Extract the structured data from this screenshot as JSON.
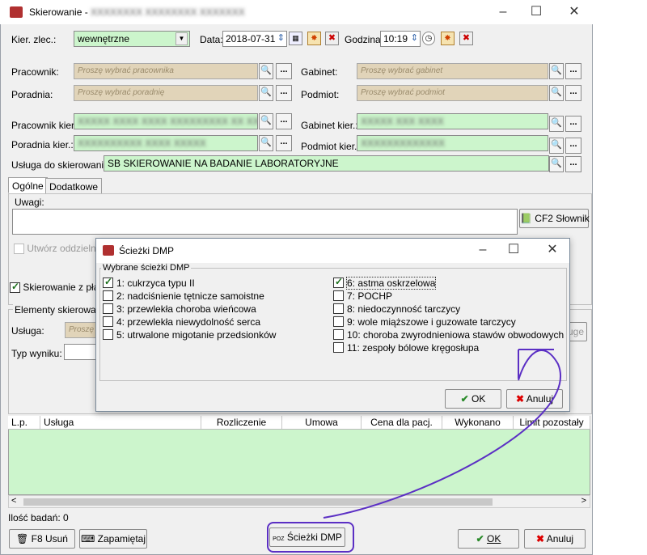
{
  "window": {
    "title": "Skierowanie -",
    "title_blurred": "XXXXXXXX XXXXXXXX XXXXXXX"
  },
  "form": {
    "kier_zlec_label": "Kier. zlec.:",
    "kier_zlec_value": "wewnętrzne",
    "data_label": "Data:",
    "data_value": "2018-07-31",
    "godzina_label": "Godzina:",
    "godzina_value": "10:19",
    "pracownik_label": "Pracownik:",
    "pracownik_placeholder": "Proszę wybrać pracownika",
    "poradnia_label": "Poradnia:",
    "poradnia_placeholder": "Proszę wybrać poradnię",
    "gabinet_label": "Gabinet:",
    "gabinet_placeholder": "Proszę wybrać gabinet",
    "podmiot_label": "Podmiot:",
    "podmiot_placeholder": "Proszę wybrać podmiot",
    "pracownik_kier_label": "Pracownik kier.:",
    "pracownik_kier_value": "XXXXX XXXX XXXX XXXXXXXXX XX XX",
    "poradnia_kier_label": "Poradnia kier.:",
    "poradnia_kier_value": "XXXXXXXXXX XXXX XXXXX",
    "gabinet_kier_label": "Gabinet kier.:",
    "gabinet_kier_value": "XXXXX XXX XXXX",
    "podmiot_kier_label": "Podmiot kier.:",
    "podmiot_kier_value": "XXXXXXXXXXXXX",
    "usluga_label": "Usługa do skierowania:",
    "usluga_value": "SB SKIEROWANIE NA BADANIE LABORATORYJNE"
  },
  "tabs": [
    "Ogólne",
    "Dodatkowe"
  ],
  "uwagi_label": "Uwagi:",
  "slownik_label": "CF2 Słownik",
  "utworz_label": "Utwórz oddzielne",
  "skierowanie_z_platn_label": "Skierowanie z płat",
  "elementy_label": "Elementy skierowania",
  "usluga2_label": "Usługa:",
  "usluga2_placeholder": "Proszę",
  "typ_wyniku_label": "Typ wyniku:",
  "uge_label": "uge",
  "grid": {
    "columns": [
      "L.p.",
      "Usługa",
      "Rozliczenie",
      "Umowa",
      "Cena dla pacj.",
      "Wykonano",
      "Limit pozostały"
    ]
  },
  "ilosc_badan": "Ilość badań: 0",
  "footer": {
    "usun": "F8 Usuń",
    "zapamietaj": "Zapamiętaj",
    "sciezki": "Ścieżki DMP",
    "ok": "OK",
    "anuluj": "Anuluj"
  },
  "dialog": {
    "title": "Ścieżki DMP",
    "group_label": "Wybrane ścieżki DMP",
    "left_options": [
      {
        "label": "1: cukrzyca typu II",
        "checked": true
      },
      {
        "label": "2: nadciśnienie tętnicze samoistne",
        "checked": false
      },
      {
        "label": "3: przewlekła choroba wieńcowa",
        "checked": false
      },
      {
        "label": "4: przewlekła niewydolność serca",
        "checked": false
      },
      {
        "label": "5: utrwalone migotanie przedsionków",
        "checked": false
      }
    ],
    "right_options": [
      {
        "label": "6: astma oskrzelowa",
        "checked": true
      },
      {
        "label": "7: POCHP",
        "checked": false
      },
      {
        "label": "8: niedoczynność tarczycy",
        "checked": false
      },
      {
        "label": "9: wole miąższowe i guzowate tarczycy",
        "checked": false
      },
      {
        "label": "10: choroba zwyrodnieniowa stawów obwodowych",
        "checked": false
      },
      {
        "label": "11: zespoły bólowe kręgosłupa",
        "checked": false
      }
    ],
    "ok": "OK",
    "anuluj": "Anuluj"
  },
  "colors": {
    "annotation": "#5b2fc4",
    "field_green": "#ccf5cc",
    "field_disabled": "#e1d4b9"
  }
}
